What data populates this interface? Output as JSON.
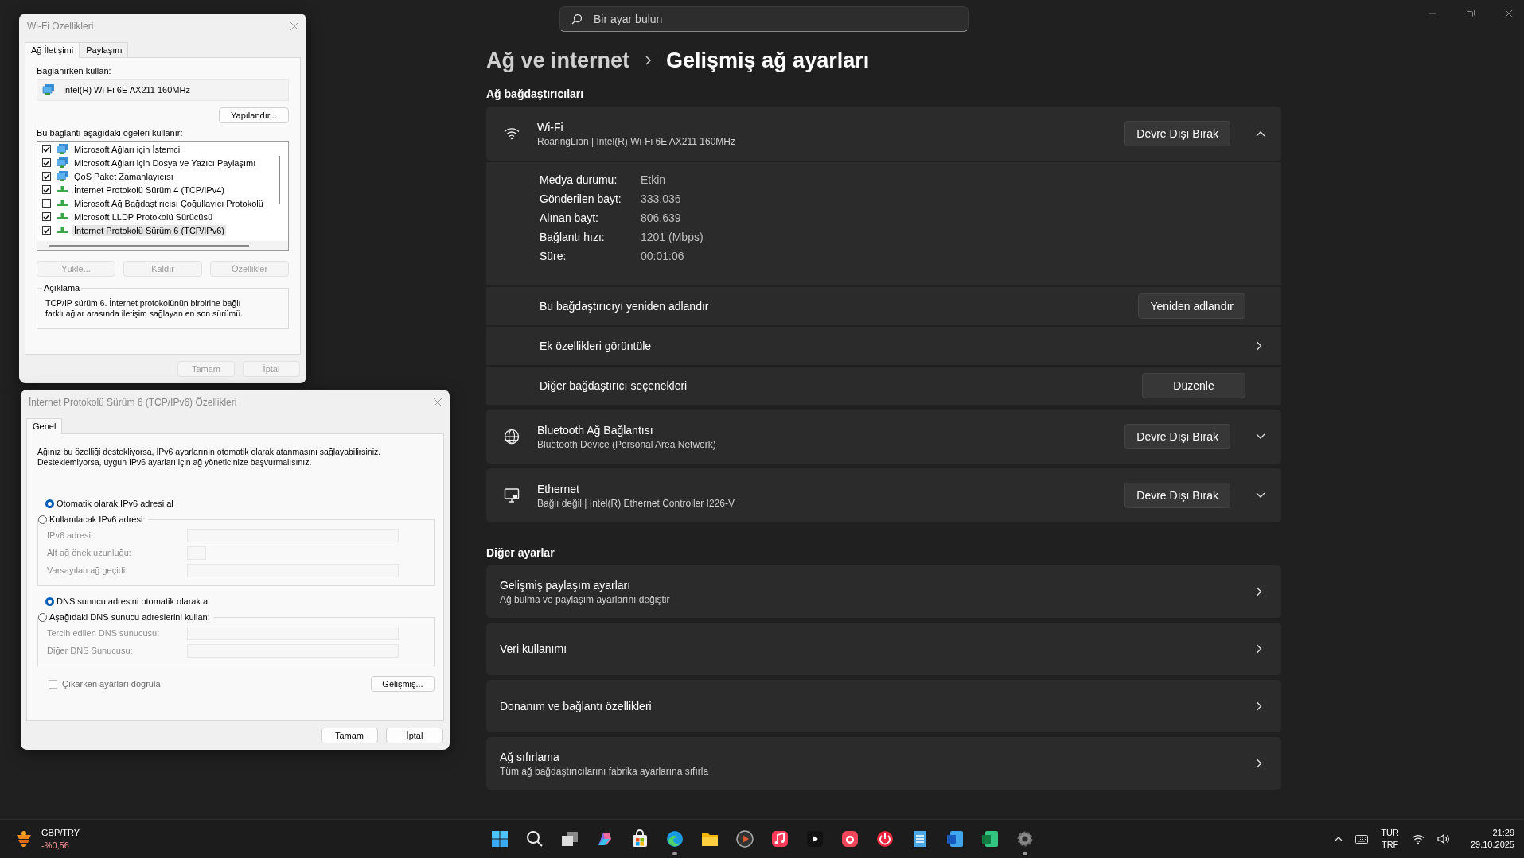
{
  "settings": {
    "search": {
      "placeholder": "Bir ayar bulun"
    },
    "breadcrumb": [
      "Ağ ve internet",
      "Gelişmiş ağ ayarları"
    ],
    "adapters_title": "Ağ bağdaştırıcıları",
    "adapters": [
      {
        "kind": "wifi",
        "name": "Wi-Fi",
        "detail": "RoaringLion | Intel(R) Wi-Fi 6E AX211 160MHz",
        "button": "Devre Dışı Bırak",
        "expanded": true,
        "properties": [
          {
            "label": "Medya durumu:",
            "value": "Etkin"
          },
          {
            "label": "Gönderilen bayt:",
            "value": "333.036"
          },
          {
            "label": "Alınan bayt:",
            "value": "806.639"
          },
          {
            "label": "Bağlantı hızı:",
            "value": "1201 (Mbps)"
          },
          {
            "label": "Süre:",
            "value": "00:01:06"
          }
        ],
        "actions": [
          {
            "kind": "button",
            "label": "Bu bağdaştırıcıyı yeniden adlandır",
            "button": "Yeniden adlandır"
          },
          {
            "kind": "link",
            "label": "Ek özellikleri görüntüle"
          },
          {
            "kind": "button",
            "label": "Diğer bağdaştırıcı seçenekleri",
            "button": "Düzenle"
          }
        ]
      },
      {
        "kind": "bluetooth",
        "name": "Bluetooth Ağ Bağlantısı",
        "detail": "Bluetooth Device (Personal Area Network)",
        "button": "Devre Dışı Bırak",
        "expanded": false
      },
      {
        "kind": "ethernet",
        "name": "Ethernet",
        "detail": "Bağlı değil | Intel(R) Ethernet Controller I226-V",
        "button": "Devre Dışı Bırak",
        "expanded": false
      }
    ],
    "other_title": "Diğer ayarlar",
    "other": [
      {
        "title": "Gelişmiş paylaşım ayarları",
        "subtitle": "Ağ bulma ve paylaşım ayarlarını değiştir"
      },
      {
        "title": "Veri kullanımı"
      },
      {
        "title": "Donanım ve bağlantı özellikleri"
      },
      {
        "title": "Ağ sıfırlama",
        "subtitle": "Tüm ağ bağdaştırıcılarını fabrika ayarlarına sıfırla"
      }
    ]
  },
  "wifi_dialog": {
    "title": "Wi-Fi Özellikleri",
    "tabs": [
      {
        "label": "Ağ İletişimi",
        "selected": true
      },
      {
        "label": "Paylaşım",
        "selected": false
      }
    ],
    "connect_label": "Bağlanırken kullan:",
    "adapter": "Intel(R) Wi-Fi 6E AX211 160MHz",
    "configure_button": "Yapılandır...",
    "items_label": "Bu bağlantı aşağıdaki öğeleri kullanır:",
    "components": [
      {
        "kind": "client",
        "label": "Microsoft Ağları için İstemci",
        "checked": true,
        "selected": false
      },
      {
        "kind": "client",
        "label": "Microsoft Ağları için Dosya ve Yazıcı Paylaşımı",
        "checked": true,
        "selected": false
      },
      {
        "kind": "client",
        "label": "QoS Paket Zamanlayıcısı",
        "checked": true,
        "selected": false
      },
      {
        "kind": "protocol",
        "label": "İnternet Protokolü Sürüm 4 (TCP/IPv4)",
        "checked": true,
        "selected": false
      },
      {
        "kind": "protocol",
        "label": "Microsoft Ağ Bağdaştırıcısı Çoğullayıcı Protokolü",
        "checked": false,
        "selected": false
      },
      {
        "kind": "protocol",
        "label": "Microsoft LLDP Protokolü Sürücüsü",
        "checked": true,
        "selected": false
      },
      {
        "kind": "protocol",
        "label": "İnternet Protokolü Sürüm 6 (TCP/IPv6)",
        "checked": true,
        "selected": true
      }
    ],
    "item_buttons": [
      {
        "label": "Yükle...",
        "disabled": true
      },
      {
        "label": "Kaldır",
        "disabled": true
      },
      {
        "label": "Özellikler",
        "disabled": true
      }
    ],
    "description_title": "Açıklama",
    "description": "TCP/IP sürüm 6. İnternet protokolünün birbirine bağlı farklı ağlar arasında iletişim sağlayan en son sürümü.",
    "buttons": [
      {
        "label": "Tamam",
        "disabled": true
      },
      {
        "label": "İptal",
        "disabled": true
      }
    ]
  },
  "ipv6_dialog": {
    "title": "İnternet Protokolü Sürüm 6 (TCP/IPv6) Özellikleri",
    "tabs": [
      {
        "label": "Genel",
        "selected": true
      }
    ],
    "intro": "Ağınız bu özelliği destekliyorsa, IPv6 ayarlarının otomatik olarak atanmasını sağlayabilirsiniz. Desteklemiyorsa, uygun IPv6 ayarları için ağ yöneticinize başvurmalısınız.",
    "ip_options": [
      {
        "label": "Otomatik olarak IPv6 adresi al",
        "selected": true
      },
      {
        "label": "Kullanılacak IPv6 adresi:",
        "selected": false
      }
    ],
    "ip_fields": [
      {
        "label": "IPv6 adresi:",
        "kind": "wide"
      },
      {
        "label": "Alt ağ önek uzunluğu:",
        "kind": "short"
      },
      {
        "label": "Varsayılan ağ geçidi:",
        "kind": "wide"
      }
    ],
    "dns_options": [
      {
        "label": "DNS sunucu adresini otomatik olarak al",
        "selected": true
      },
      {
        "label": "Aşağıdaki DNS sunucu adreslerini kullan:",
        "selected": false
      }
    ],
    "dns_fields": [
      {
        "label": "Tercih edilen DNS sunucusu:",
        "kind": "wide"
      },
      {
        "label": "Diğer DNS Sunucusu:",
        "kind": "wide"
      }
    ],
    "validate": {
      "label": "Çıkarken ayarları doğrula",
      "checked": false
    },
    "advanced_button": "Gelişmiş...",
    "buttons": [
      {
        "label": "Tamam",
        "disabled": false
      },
      {
        "label": "İptal",
        "disabled": false
      }
    ]
  },
  "taskbar": {
    "widget": {
      "name": "GBP/TRY",
      "change": "-%0,56"
    },
    "apps": [
      {
        "kind": "start",
        "running": false
      },
      {
        "kind": "search",
        "running": false
      },
      {
        "kind": "taskview",
        "running": false
      },
      {
        "kind": "copilot",
        "running": false
      },
      {
        "kind": "store",
        "running": false
      },
      {
        "kind": "edge",
        "running": true
      },
      {
        "kind": "explorer",
        "running": false
      },
      {
        "kind": "media",
        "running": false
      },
      {
        "kind": "music",
        "running": false
      },
      {
        "kind": "tv",
        "running": false
      },
      {
        "kind": "red",
        "running": false
      },
      {
        "kind": "power",
        "running": false
      },
      {
        "kind": "notepad",
        "running": false
      },
      {
        "kind": "word",
        "running": false
      },
      {
        "kind": "excel",
        "running": false
      },
      {
        "kind": "settings",
        "running": true
      }
    ],
    "language": [
      "TUR",
      "TRF"
    ],
    "time": "21:29",
    "date": "29.10.2025"
  }
}
